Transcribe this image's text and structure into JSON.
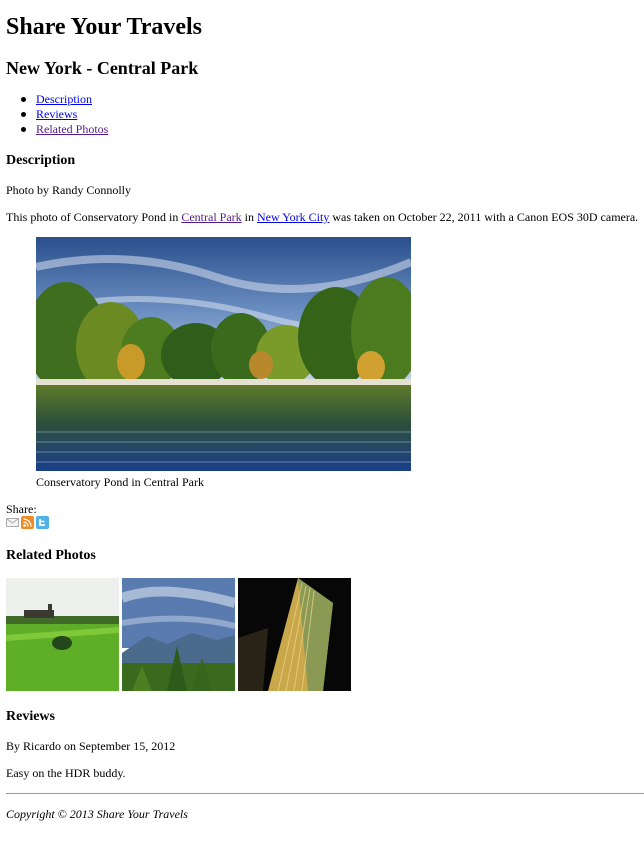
{
  "site_title": "Share Your Travels",
  "photo_title": "New York - Central Park",
  "nav": [
    {
      "label": "Description"
    },
    {
      "label": "Reviews"
    },
    {
      "label": "Related Photos"
    }
  ],
  "description": {
    "heading": "Description",
    "byline": "Photo by Randy Connolly",
    "text_before": "This photo of Conservatory Pond in ",
    "link1": "Central Park",
    "text_mid": " in ",
    "link2": "New York City",
    "text_after": " was taken on October 22, 2011 with a Canon EOS 30D camera."
  },
  "figure": {
    "caption": "Conservatory Pond in Central Park"
  },
  "share": {
    "label": "Share:",
    "icons": [
      "email-icon",
      "rss-icon",
      "twitter-icon"
    ]
  },
  "related": {
    "heading": "Related Photos",
    "thumbs": [
      "field-with-barn",
      "mountain-valley",
      "skyscraper-night"
    ]
  },
  "reviews": {
    "heading": "Reviews",
    "byline": "By Ricardo on September 15, 2012",
    "text": "Easy on the HDR buddy."
  },
  "footer": "Copyright © 2013 Share Your Travels"
}
